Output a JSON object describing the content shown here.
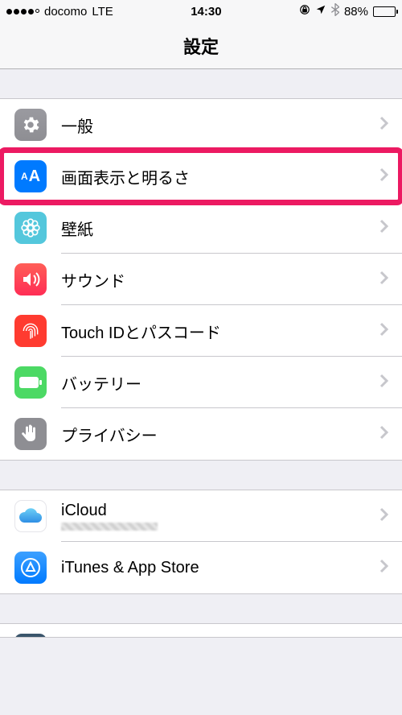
{
  "status": {
    "carrier": "docomo",
    "network": "LTE",
    "time": "14:30",
    "battery_pct": "88%"
  },
  "nav": {
    "title": "設定"
  },
  "group1": {
    "general": "一般",
    "display": "画面表示と明るさ",
    "wallpaper": "壁紙",
    "sound": "サウンド",
    "touchid": "Touch IDとパスコード",
    "battery": "バッテリー",
    "privacy": "プライバシー"
  },
  "group2": {
    "icloud": "iCloud",
    "itunes": "iTunes & App Store"
  },
  "highlight": {
    "target": "display"
  }
}
